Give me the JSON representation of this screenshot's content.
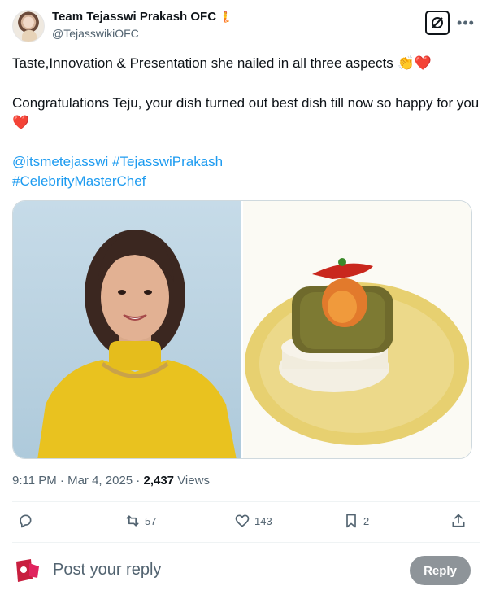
{
  "author": {
    "name": "Team Tejasswi Prakash OFC",
    "badge_icon": "mermaid-emoji-icon",
    "handle": "@TejasswikiOFC"
  },
  "header": {
    "grok_icon": "grok-icon",
    "more_icon": "more-icon"
  },
  "tweet": {
    "line1": "Taste,Innovation & Presentation she nailed in all three aspects",
    "line1_emojis": [
      "👏",
      "❤️"
    ],
    "line2": "Congratulations Teju, your dish turned out best dish till now so happy for you",
    "line2_emoji": "❤️",
    "tags_line1": "@itsmetejasswi #TejasswiPrakash",
    "tags_line2": "#CelebrityMasterChef"
  },
  "media": {
    "photos": [
      "woman-in-yellow-top-photo",
      "plated-dish-photo"
    ]
  },
  "meta": {
    "time": "9:11 PM",
    "separator": " · ",
    "date": "Mar 4, 2025",
    "views_count": "2,437",
    "views_label": "Views"
  },
  "actions": {
    "reply_count": "",
    "retweet_count": "57",
    "like_count": "143",
    "bookmark_count": "2"
  },
  "reply": {
    "placeholder": "Post your reply",
    "button_label": "Reply"
  },
  "colors": {
    "link": "#1d9bf0",
    "muted": "#536471",
    "reply_button": "#8e9499",
    "heart": "#e0245e"
  }
}
